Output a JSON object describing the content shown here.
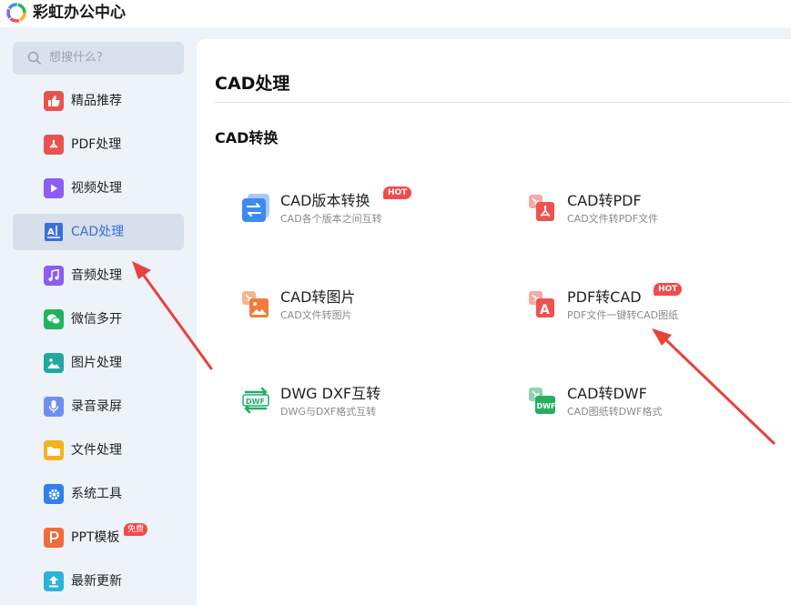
{
  "app": {
    "title": "彩虹办公中心"
  },
  "search": {
    "placeholder": "想搜什么?"
  },
  "sidebar": {
    "items": [
      {
        "label": "精品推荐",
        "icon": "thumbs-up-icon",
        "color": "#e9534f"
      },
      {
        "label": "PDF处理",
        "icon": "pdf-icon",
        "color": "#e9534f"
      },
      {
        "label": "视频处理",
        "icon": "play-icon",
        "color": "#8b5cf6"
      },
      {
        "label": "CAD处理",
        "icon": "cad-icon",
        "color": "#3b6fd8",
        "active": true
      },
      {
        "label": "音频处理",
        "icon": "music-icon",
        "color": "#8b5cf6"
      },
      {
        "label": "微信多开",
        "icon": "wechat-icon",
        "color": "#22b35e"
      },
      {
        "label": "图片处理",
        "icon": "image-icon",
        "color": "#22a6a0"
      },
      {
        "label": "录音录屏",
        "icon": "microphone-icon",
        "color": "#6d8ff0"
      },
      {
        "label": "文件处理",
        "icon": "folder-icon",
        "color": "#f5b21b"
      },
      {
        "label": "系统工具",
        "icon": "gear-icon",
        "color": "#2f80ed"
      },
      {
        "label": "PPT模板",
        "icon": "ppt-icon",
        "color": "#f06a3a",
        "badge": "免费"
      },
      {
        "label": "最新更新",
        "icon": "upload-icon",
        "color": "#2bb3d9"
      }
    ]
  },
  "main": {
    "title": "CAD处理",
    "section": "CAD转换",
    "tools": [
      {
        "name": "CAD版本转换",
        "desc": "CAD各个版本之间互转",
        "badge": "HOT",
        "icon": "version-convert-icon",
        "color": "#3d8af0"
      },
      {
        "name": "CAD转PDF",
        "desc": "CAD文件转PDF文件",
        "icon": "cad-to-pdf-icon",
        "color": "#ef5350"
      },
      {
        "name": "CAD转图片",
        "desc": "CAD文件转图片",
        "icon": "cad-to-image-icon",
        "color": "#f47a3a"
      },
      {
        "name": "PDF转CAD",
        "desc": "PDF文件一键转CAD图纸",
        "badge": "HOT",
        "icon": "pdf-to-cad-icon",
        "color": "#ef5350"
      },
      {
        "name": "DWG DXF互转",
        "desc": "DWG与DXF格式互转",
        "icon": "dwg-dxf-icon",
        "color": "#1fae6a",
        "icon_text": "DWF"
      },
      {
        "name": "CAD转DWF",
        "desc": "CAD图纸转DWF格式",
        "icon": "cad-to-dwf-icon",
        "color": "#27ae60",
        "icon_text": "DWF"
      }
    ]
  },
  "annotation_color": "#e9423b"
}
